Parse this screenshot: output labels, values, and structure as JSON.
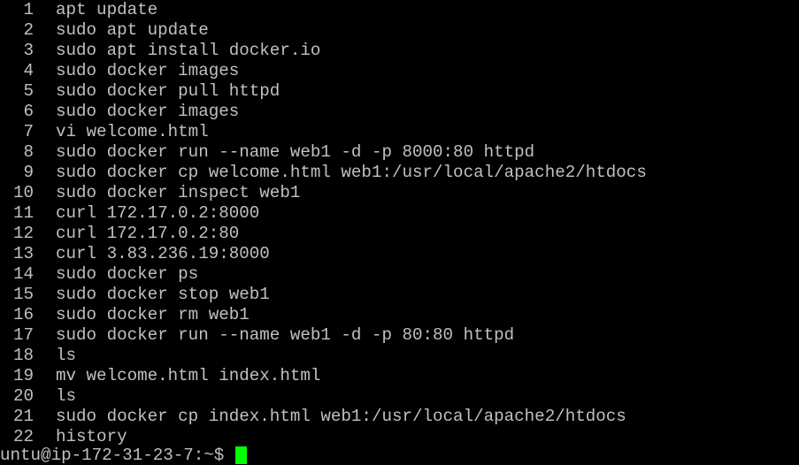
{
  "terminal": {
    "colors": {
      "background": "#000000",
      "foreground": "#c0c0c0",
      "cursor": "#00ff00"
    },
    "history": [
      {
        "num": "1",
        "cmd": "apt update"
      },
      {
        "num": "2",
        "cmd": "sudo apt update"
      },
      {
        "num": "3",
        "cmd": "sudo apt install docker.io"
      },
      {
        "num": "4",
        "cmd": "sudo docker images"
      },
      {
        "num": "5",
        "cmd": "sudo docker pull httpd"
      },
      {
        "num": "6",
        "cmd": "sudo docker images"
      },
      {
        "num": "7",
        "cmd": "vi welcome.html"
      },
      {
        "num": "8",
        "cmd": "sudo docker run --name web1 -d -p 8000:80 httpd"
      },
      {
        "num": "9",
        "cmd": "sudo docker cp welcome.html web1:/usr/local/apache2/htdocs"
      },
      {
        "num": "10",
        "cmd": "sudo docker inspect web1"
      },
      {
        "num": "11",
        "cmd": "curl 172.17.0.2:8000"
      },
      {
        "num": "12",
        "cmd": "curl 172.17.0.2:80"
      },
      {
        "num": "13",
        "cmd": "curl 3.83.236.19:8000"
      },
      {
        "num": "14",
        "cmd": "sudo docker ps"
      },
      {
        "num": "15",
        "cmd": "sudo docker stop web1"
      },
      {
        "num": "16",
        "cmd": "sudo docker rm web1"
      },
      {
        "num": "17",
        "cmd": "sudo docker run --name web1 -d -p 80:80 httpd"
      },
      {
        "num": "18",
        "cmd": "ls"
      },
      {
        "num": "19",
        "cmd": "mv welcome.html index.html"
      },
      {
        "num": "20",
        "cmd": "ls"
      },
      {
        "num": "21",
        "cmd": "sudo docker cp index.html web1:/usr/local/apache2/htdocs"
      },
      {
        "num": "22",
        "cmd": "history"
      }
    ],
    "prompt": "untu@ip-172-31-23-7:~$"
  }
}
